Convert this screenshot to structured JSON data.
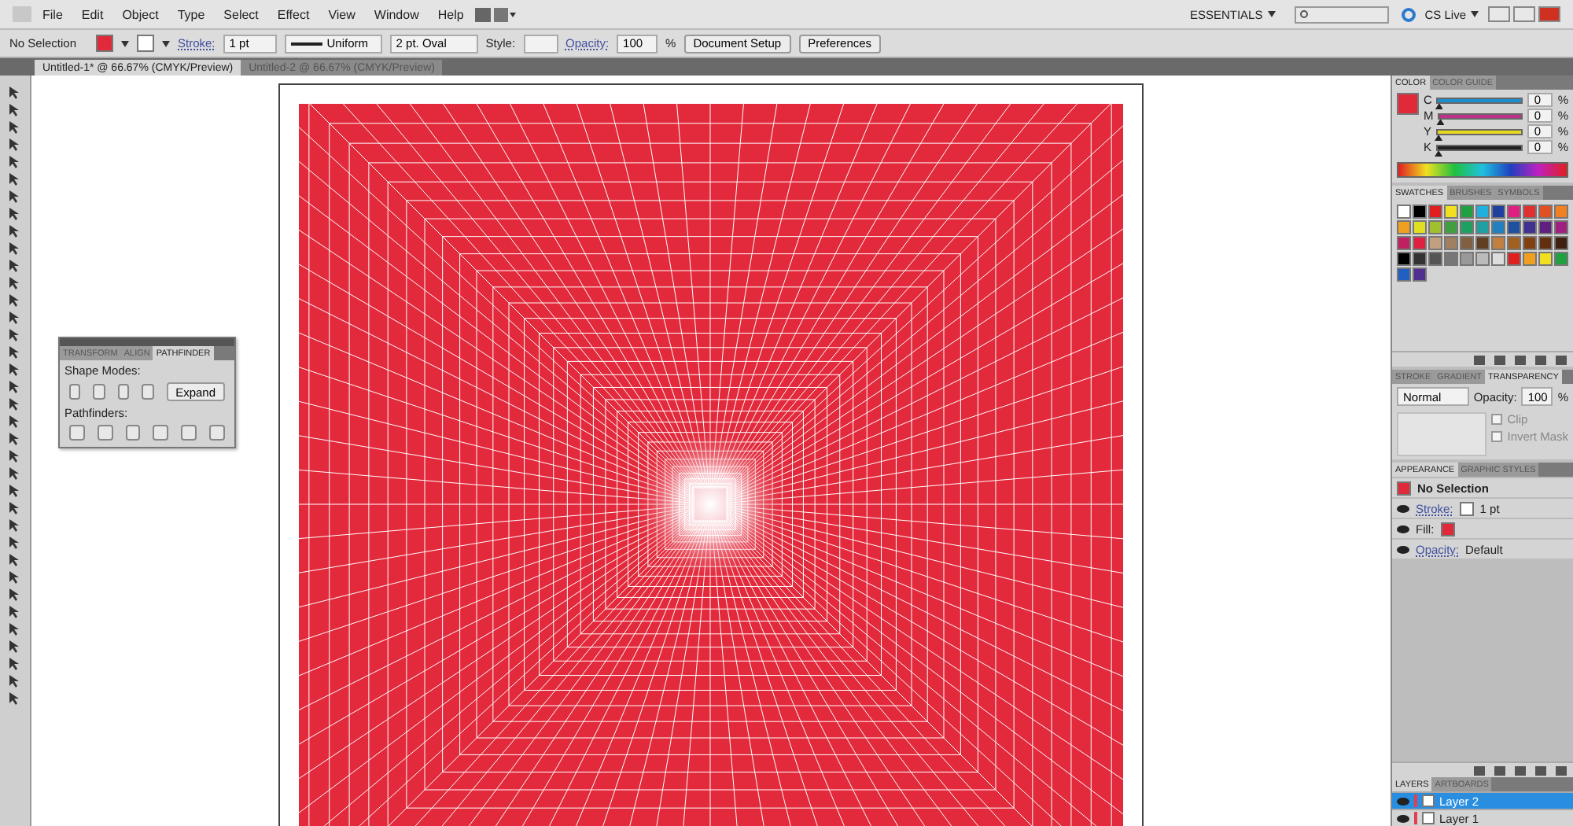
{
  "menu": [
    "File",
    "Edit",
    "Object",
    "Type",
    "Select",
    "Effect",
    "View",
    "Window",
    "Help"
  ],
  "workspace": {
    "label": "ESSENTIALS",
    "cs_live": "CS Live"
  },
  "control_bar": {
    "selection": "No Selection",
    "fill": {
      "color": "#e02a3a"
    },
    "stroke_link": "Stroke:",
    "stroke_weight": "1 pt",
    "profile": "Uniform",
    "brush": "2 pt. Oval",
    "style_label": "Style:",
    "opacity_link": "Opacity:",
    "opacity": "100",
    "percent": "%",
    "buttons": [
      "Document Setup",
      "Preferences"
    ]
  },
  "documents": [
    {
      "title": "Untitled-1* @ 66.67% (CMYK/Preview)",
      "selected": true
    },
    {
      "title": "Untitled-2 @ 66.67% (CMYK/Preview)",
      "selected": false
    }
  ],
  "pathfinder_panel": {
    "tabs": [
      {
        "label": "TRANSFORM",
        "selected": false
      },
      {
        "label": "ALIGN",
        "selected": false
      },
      {
        "label": "PATHFINDER",
        "selected": true
      }
    ],
    "shape_modes": "Shape Modes:",
    "expand": "Expand",
    "pathfinders": "Pathfinders:"
  },
  "color_panel": {
    "tabs": [
      {
        "label": "COLOR",
        "selected": true
      },
      {
        "label": "COLOR GUIDE",
        "selected": false
      }
    ],
    "channels": [
      {
        "name": "C",
        "value": "0",
        "unit": "%",
        "level": 0,
        "color": "#1c8fd0"
      },
      {
        "name": "M",
        "value": "0",
        "unit": "%",
        "level": 0,
        "color": "#c0308a"
      },
      {
        "name": "Y",
        "value": "0",
        "unit": "%",
        "level": 0,
        "color": "#e8d820"
      },
      {
        "name": "K",
        "value": "0",
        "unit": "%",
        "level": 0,
        "color": "#202020"
      }
    ]
  },
  "swatches_panel": {
    "tabs": [
      {
        "label": "SWATCHES",
        "selected": true
      },
      {
        "label": "BRUSHES",
        "selected": false
      },
      {
        "label": "SYMBOLS",
        "selected": false
      }
    ],
    "swatches": [
      {
        "color": "#ffffff"
      },
      {
        "color": "#000000"
      },
      {
        "color": "#e02020"
      },
      {
        "color": "#f0e020"
      },
      {
        "color": "#20a040"
      },
      {
        "color": "#20b0e0"
      },
      {
        "color": "#2040a0"
      },
      {
        "color": "#e02080"
      },
      {
        "color": "#e03030"
      },
      {
        "color": "#e05020"
      },
      {
        "color": "#f08020"
      },
      {
        "color": "#f0a020"
      },
      {
        "color": "#e0e020"
      },
      {
        "color": "#a0c030"
      },
      {
        "color": "#40a040"
      },
      {
        "color": "#20a060"
      },
      {
        "color": "#20a0a0"
      },
      {
        "color": "#2080c0"
      },
      {
        "color": "#2050a0"
      },
      {
        "color": "#403090"
      },
      {
        "color": "#602080"
      },
      {
        "color": "#a02080"
      },
      {
        "color": "#c02060"
      },
      {
        "color": "#e02040"
      },
      {
        "color": "#c0a080"
      },
      {
        "color": "#a08060"
      },
      {
        "color": "#806040"
      },
      {
        "color": "#604020"
      },
      {
        "color": "#c08040"
      },
      {
        "color": "#a06020"
      },
      {
        "color": "#804010"
      },
      {
        "color": "#603010"
      },
      {
        "color": "#402010"
      },
      {
        "color": "#000000"
      },
      {
        "color": "#333333"
      },
      {
        "color": "#555555"
      },
      {
        "color": "#777777"
      },
      {
        "color": "#999999"
      },
      {
        "color": "#bbbbbb"
      },
      {
        "color": "#dddddd"
      },
      {
        "color": "#e02020"
      },
      {
        "color": "#f0a020"
      },
      {
        "color": "#f0e020"
      },
      {
        "color": "#20a040"
      },
      {
        "color": "#2060c0"
      },
      {
        "color": "#503090"
      }
    ]
  },
  "transparency_panel": {
    "tabs": [
      {
        "label": "STROKE",
        "selected": false
      },
      {
        "label": "GRADIENT",
        "selected": false
      },
      {
        "label": "TRANSPARENCY",
        "selected": true
      }
    ],
    "blend_mode": "Normal",
    "opacity_label": "Opacity:",
    "opacity": "100",
    "percent": "%",
    "options": [
      {
        "label": "Clip",
        "checked": false
      },
      {
        "label": "Invert Mask",
        "checked": false
      }
    ]
  },
  "appearance_panel": {
    "tabs": [
      {
        "label": "APPEARANCE",
        "selected": true
      },
      {
        "label": "GRAPHIC STYLES",
        "selected": false
      }
    ],
    "title": "No Selection",
    "rows": [
      {
        "kind": "stroke",
        "label": "Stroke:",
        "value": "1 pt",
        "color": "#ffffff"
      },
      {
        "kind": "fill",
        "label": "Fill:",
        "color": "#e02a3a"
      },
      {
        "kind": "opacity",
        "label": "Opacity:",
        "value": "Default"
      }
    ]
  },
  "layers_panel": {
    "tabs": [
      {
        "label": "LAYERS",
        "selected": true
      },
      {
        "label": "ARTBOARDS",
        "selected": false
      }
    ],
    "layers": [
      {
        "name": "Layer 2",
        "selected": true,
        "color": "#e04050"
      },
      {
        "name": "Layer 1",
        "selected": false,
        "color": "#e04050"
      }
    ]
  }
}
